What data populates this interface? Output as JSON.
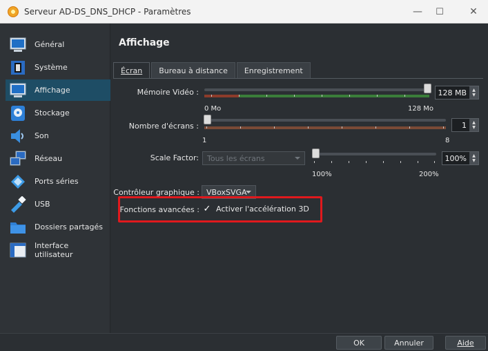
{
  "window": {
    "title": "Serveur AD-DS_DNS_DHCP - Paramètres",
    "minimize": "—",
    "maximize": "☐",
    "close": "✕"
  },
  "sidebar": {
    "items": [
      {
        "label": "Général",
        "icon": "general-monitor-icon"
      },
      {
        "label": "Système",
        "icon": "system-chip-icon"
      },
      {
        "label": "Affichage",
        "icon": "display-monitor-icon",
        "selected": true
      },
      {
        "label": "Stockage",
        "icon": "storage-disk-icon"
      },
      {
        "label": "Son",
        "icon": "speaker-icon"
      },
      {
        "label": "Réseau",
        "icon": "network-icon"
      },
      {
        "label": "Ports séries",
        "icon": "serial-port-icon"
      },
      {
        "label": "USB",
        "icon": "usb-icon"
      },
      {
        "label": "Dossiers partagés",
        "icon": "shared-folder-icon"
      },
      {
        "label": "Interface utilisateur",
        "icon": "user-interface-icon"
      }
    ]
  },
  "main": {
    "title": "Affichage",
    "tabs": [
      {
        "label": "Écran",
        "active": true
      },
      {
        "label": "Bureau à distance"
      },
      {
        "label": "Enregistrement"
      }
    ],
    "video_memory": {
      "label": "Mémoire Vidéo :",
      "value": "128 MB",
      "min_label": "0 Mo",
      "max_label": "128 Mo",
      "level": 1.0
    },
    "monitors": {
      "label": "Nombre d'écrans :",
      "value": "1",
      "min_label": "1",
      "max_label": "8",
      "level": 0.0
    },
    "scale": {
      "label": "Scale Factor:",
      "combo_value": "Tous les écrans",
      "value": "100%",
      "min_label": "100%",
      "max_label": "200%",
      "level": 0.0
    },
    "graphics_controller": {
      "label": "Contrôleur graphique :",
      "value": "VBoxSVGA"
    },
    "advanced": {
      "label": "Fonctions avancées :",
      "checkbox_label": "Activer l'accélération 3D",
      "checked": true,
      "check_mark": "✓"
    }
  },
  "buttons": {
    "ok": "OK",
    "cancel": "Annuler",
    "help": "Aide"
  },
  "colors": {
    "accent_selected": "#1e4d65",
    "highlight_box": "#e0191d"
  }
}
